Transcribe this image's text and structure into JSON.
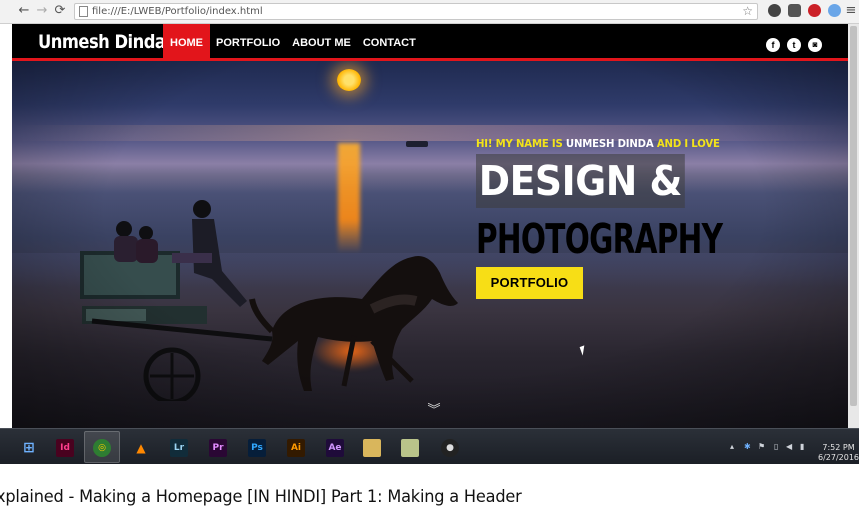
{
  "browser": {
    "url": "file:///E:/LWEB/Portfolio/index.html",
    "nav": {
      "back": "←",
      "forward": "→",
      "reload": "⟳"
    },
    "icons": [
      "bookmark-star-icon",
      "extension-icon",
      "shield-icon",
      "pinterest-icon",
      "chrome-menu-icon"
    ]
  },
  "site": {
    "brand": "Unmesh Dinda",
    "menu": [
      {
        "label": "HOME",
        "active": true
      },
      {
        "label": "PORTFOLIO",
        "active": false
      },
      {
        "label": "ABOUT ME",
        "active": false
      },
      {
        "label": "CONTACT",
        "active": false
      }
    ],
    "social": [
      {
        "icon": "facebook-icon",
        "glyph": "f"
      },
      {
        "icon": "twitter-icon",
        "glyph": "t"
      },
      {
        "icon": "instagram-icon",
        "glyph": "◙"
      }
    ]
  },
  "hero": {
    "tagline": {
      "part1": "HI! MY NAME IS ",
      "part2": "UNMESH DINDA",
      "part3": " AND I LOVE"
    },
    "headline1": "DESIGN &",
    "headline2": "PHOTOGRAPHY",
    "cta": "PORTFOLIO",
    "scroll_hint": "»"
  },
  "taskbar": {
    "apps": [
      {
        "icon": "windows-start-icon",
        "label": "⊞"
      },
      {
        "icon": "indesign-icon",
        "label": "Id"
      },
      {
        "icon": "chrome-icon",
        "label": "◎"
      },
      {
        "icon": "vlc-icon",
        "label": "▲"
      },
      {
        "icon": "lightroom-icon",
        "label": "Lr"
      },
      {
        "icon": "premiere-icon",
        "label": "Pr"
      },
      {
        "icon": "photoshop-icon",
        "label": "Ps"
      },
      {
        "icon": "illustrator-icon",
        "label": "Ai"
      },
      {
        "icon": "after-effects-icon",
        "label": "Ae"
      },
      {
        "icon": "folder-icon",
        "label": ""
      },
      {
        "icon": "notes-icon",
        "label": ""
      },
      {
        "icon": "obs-icon",
        "label": "●"
      }
    ],
    "time": "7:52 PM",
    "date": "6/27/2016"
  },
  "caption": "xplained - Making a Homepage [IN HINDI] Part 1: Making a Header",
  "colors": {
    "accent_red": "#e2151b",
    "cta_yellow": "#f7de16",
    "tagline_yellow": "#f2e31a"
  }
}
